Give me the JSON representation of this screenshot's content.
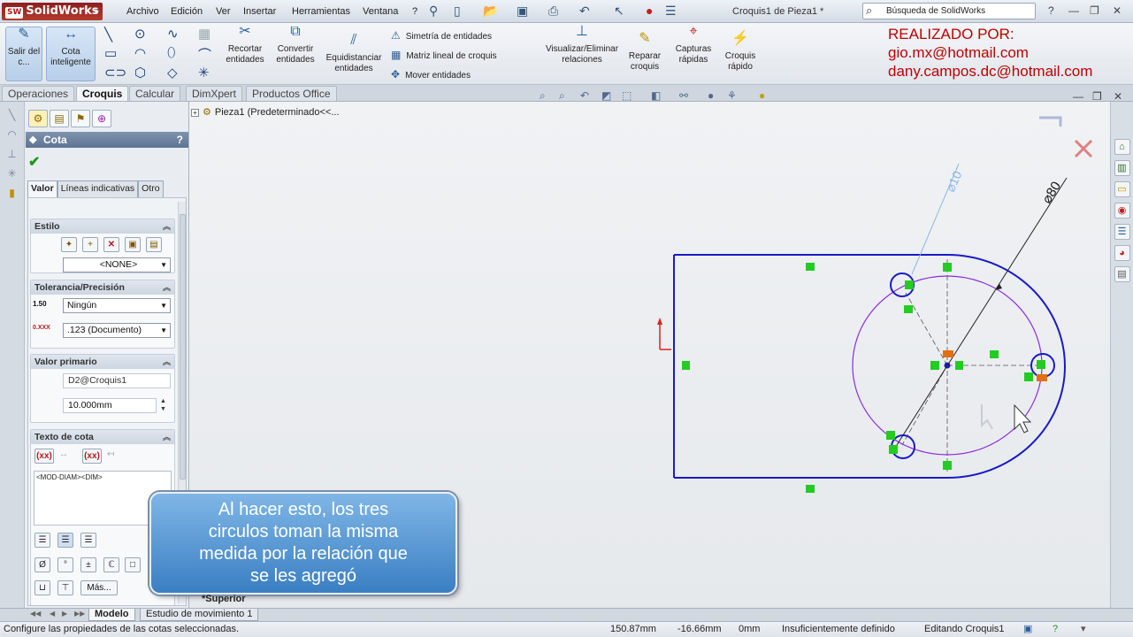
{
  "app": {
    "logo_text": "SolidWorks",
    "document_title": "Croquis1 de Pieza1 *"
  },
  "menu": [
    "Archivo",
    "Edición",
    "Ver",
    "Insertar",
    "Herramientas",
    "Ventana",
    "?"
  ],
  "search": {
    "placeholder": "Búsqueda de SolidWorks"
  },
  "ribbon": {
    "exit_sketch": "Salir del c...",
    "smart_dimension": "Cota inteligente",
    "trim": "Recortar entidades",
    "convert": "Convertir entidades",
    "offset": "Equidistanciar entidades",
    "mirror": "Simetría de entidades",
    "linear_pattern": "Matriz lineal de croquis",
    "move": "Mover entidades",
    "display_relations": "Visualizar/Eliminar relaciones",
    "repair": "Reparar croquis",
    "quick_snaps": "Capturas rápidas",
    "rapid_sketch": "Croquis rápido"
  },
  "credits": {
    "line1": "REALIZADO POR:",
    "line2": "gio.mx@hotmail.com",
    "line3": "dany.campos.dc@hotmail.com"
  },
  "tabs": [
    "Operaciones",
    "Croquis",
    "Calcular",
    "DimXpert",
    "Productos Office"
  ],
  "active_tab": "Croquis",
  "pm": {
    "title": "Cota",
    "help": "?",
    "subtabs": [
      "Valor",
      "Líneas indicativas",
      "Otro"
    ],
    "style": {
      "header": "Estilo",
      "value": "<NONE>"
    },
    "tolerance": {
      "header": "Tolerancia/Precisión",
      "type": "Ningún",
      "precision": ".123 (Documento)",
      "tol_icon_text": "1.50",
      "prec_icon_text": "0.XXX"
    },
    "primary": {
      "header": "Valor primario",
      "name": "D2@Croquis1",
      "value": "10.000mm"
    },
    "dimtext": {
      "header": "Texto de cota",
      "content": "<MOD-DIAM><DIM>",
      "more": "Más...",
      "token": "(xx)"
    },
    "symbols": [
      "Ø",
      "°",
      "±",
      "ℂ",
      "□"
    ]
  },
  "graphics": {
    "tree_root": "Pieza1  (Predeterminado<<...",
    "view_label": "*Superior",
    "dim_small": "⌀10",
    "dim_large": "⌀80",
    "callout": "Al hacer esto, los tres\ncirculos toman la misma\nmedida por la relación que\nse les agregó"
  },
  "model_tabs": [
    "Modelo",
    "Estudio de movimiento 1"
  ],
  "status": {
    "message": "Configure las propiedades de las cotas seleccionadas.",
    "x": "150.87mm",
    "y": "-16.66mm",
    "z": "0mm",
    "state": "Insuficientemente definido",
    "editing": "Editando Croquis1"
  },
  "colors": {
    "sketch_blue": "#1a1ac8",
    "sketch_purple": "#8a2be2",
    "relation_green": "#22cc22",
    "callout_blue": "#3a7fc3",
    "credits_red": "#c00000"
  }
}
